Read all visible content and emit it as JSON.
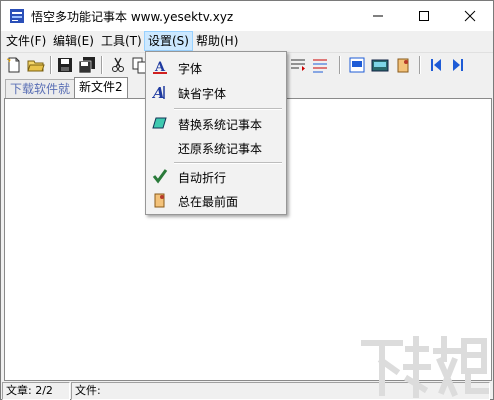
{
  "window": {
    "title": "悟空多功能记事本 www.yesektv.xyz"
  },
  "menubar": {
    "items": [
      "文件(F)",
      "编辑(E)",
      "工具(T)",
      "设置(S)",
      "帮助(H)"
    ]
  },
  "tabs": [
    "下载软件就",
    "新文件2"
  ],
  "settings_menu": {
    "items": [
      "字体",
      "缺省字体",
      "替换系统记事本",
      "还原系统记事本",
      "自动折行",
      "总在最前面"
    ]
  },
  "statusbar": {
    "chapter": "文章: 2/2",
    "file": "文件:"
  },
  "watermark": {
    "text": "下载吧"
  },
  "colors": {
    "menu_highlight": "#cce8ff",
    "tab_inactive_text": "#5a6fb5",
    "toolbar_blue": "#1e5bd6"
  }
}
